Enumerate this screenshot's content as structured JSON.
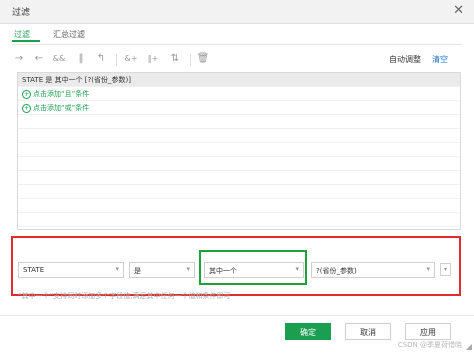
{
  "window": {
    "title": "过滤"
  },
  "tabs": [
    {
      "label": "过滤",
      "active": true
    },
    {
      "label": "汇总过滤",
      "active": false
    }
  ],
  "toolbar": {
    "icons": [
      "arrow-right-icon",
      "arrow-left-icon",
      "and-and-icon",
      "parallel-icon",
      "return-arrow-icon",
      "and-add-icon",
      "or-add-icon",
      "expand-icon",
      "delete-icon"
    ],
    "auto_adjust": "自动调整",
    "clear": "清空"
  },
  "list": {
    "condition": "STATE 是 其中一个 [?(省份_参数)]",
    "add_and": "点击添加“且”条件",
    "add_or": "点击添加“或”条件"
  },
  "editor": {
    "field": "STATE",
    "operator": "是",
    "match": "其中一个",
    "value": "?(省份_参数)",
    "hint": "“其中一个”支持同时添加多个字段值,满足其中任何一个值和条件即可"
  },
  "footer": {
    "ok": "确定",
    "cancel": "取消",
    "apply": "应用"
  },
  "watermark": "CSDN @季夏荷惜晓",
  "colors": {
    "accent": "#1a9e4f",
    "highlight_red": "#e02b2b",
    "highlight_green": "#1aa33a"
  }
}
